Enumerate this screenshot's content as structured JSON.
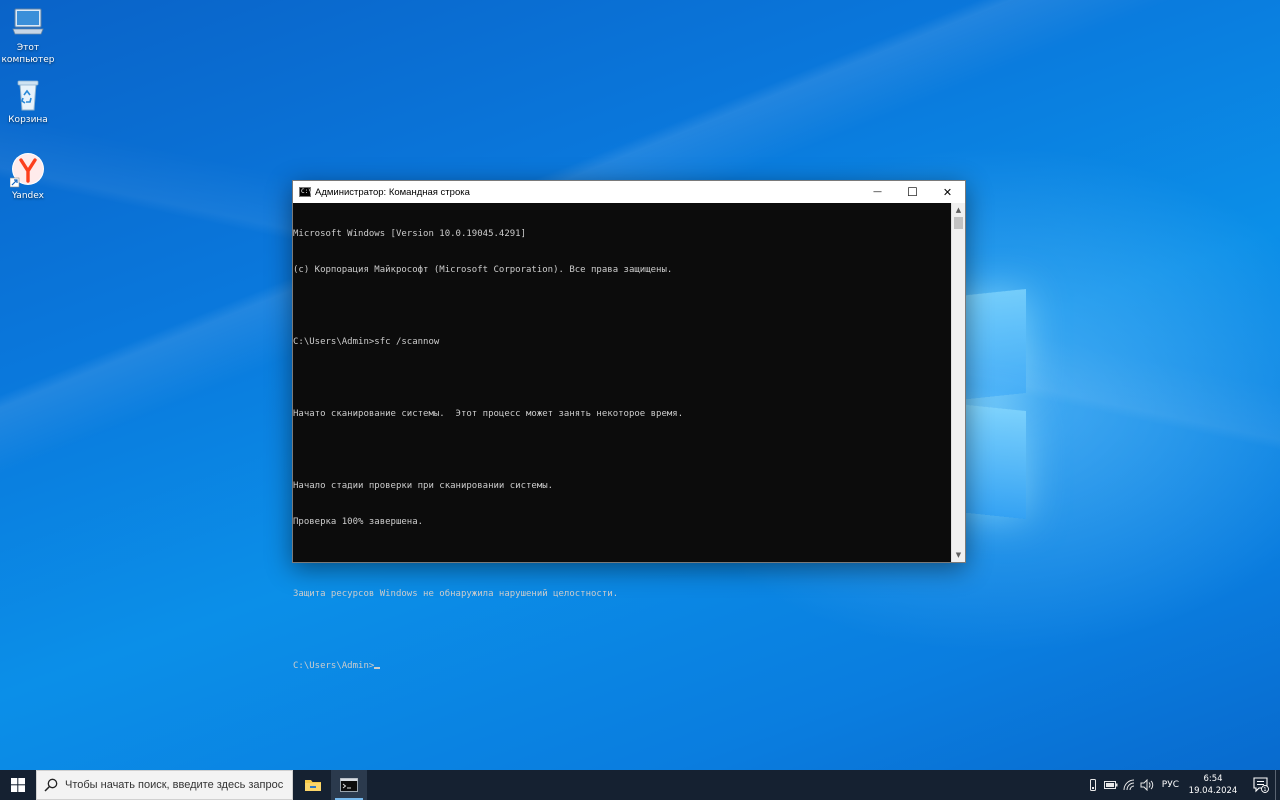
{
  "desktop": {
    "icons": [
      {
        "label_line1": "Этот",
        "label_line2": "компьютер",
        "icon": "this-pc-icon"
      },
      {
        "label_line1": "Корзина",
        "label_line2": "",
        "icon": "recycle-bin-icon"
      },
      {
        "label_line1": "Yandex",
        "label_line2": "",
        "icon": "yandex-browser-icon"
      }
    ]
  },
  "cmd_window": {
    "title": "Администратор: Командная строка",
    "app_icon_text": "C:\\",
    "controls": {
      "minimize": "—",
      "maximize": "☐",
      "close": "✕"
    },
    "lines": [
      "Microsoft Windows [Version 10.0.19045.4291]",
      "(c) Корпорация Майкрософт (Microsoft Corporation). Все права защищены.",
      "",
      "C:\\Users\\Admin>sfc /scannow",
      "",
      "Начато сканирование системы.  Этот процесс может занять некоторое время.",
      "",
      "Начало стадии проверки при сканировании системы.",
      "Проверка 100% завершена.",
      "",
      "Защита ресурсов Windows не обнаружила нарушений целостности.",
      ""
    ],
    "prompt": "C:\\Users\\Admin>"
  },
  "taskbar": {
    "search_placeholder": "Чтобы начать поиск, введите здесь запрос",
    "apps": [
      {
        "name": "file-explorer",
        "active": false
      },
      {
        "name": "command-prompt",
        "active": true
      }
    ],
    "tray": {
      "language": "РУС",
      "time": "6:54",
      "date": "19.04.2024",
      "notification_count": "1"
    }
  },
  "colors": {
    "console_bg": "#0c0c0c",
    "console_fg": "#cccccc",
    "taskbar_bg": "#152131",
    "accent": "#76b9ed"
  }
}
